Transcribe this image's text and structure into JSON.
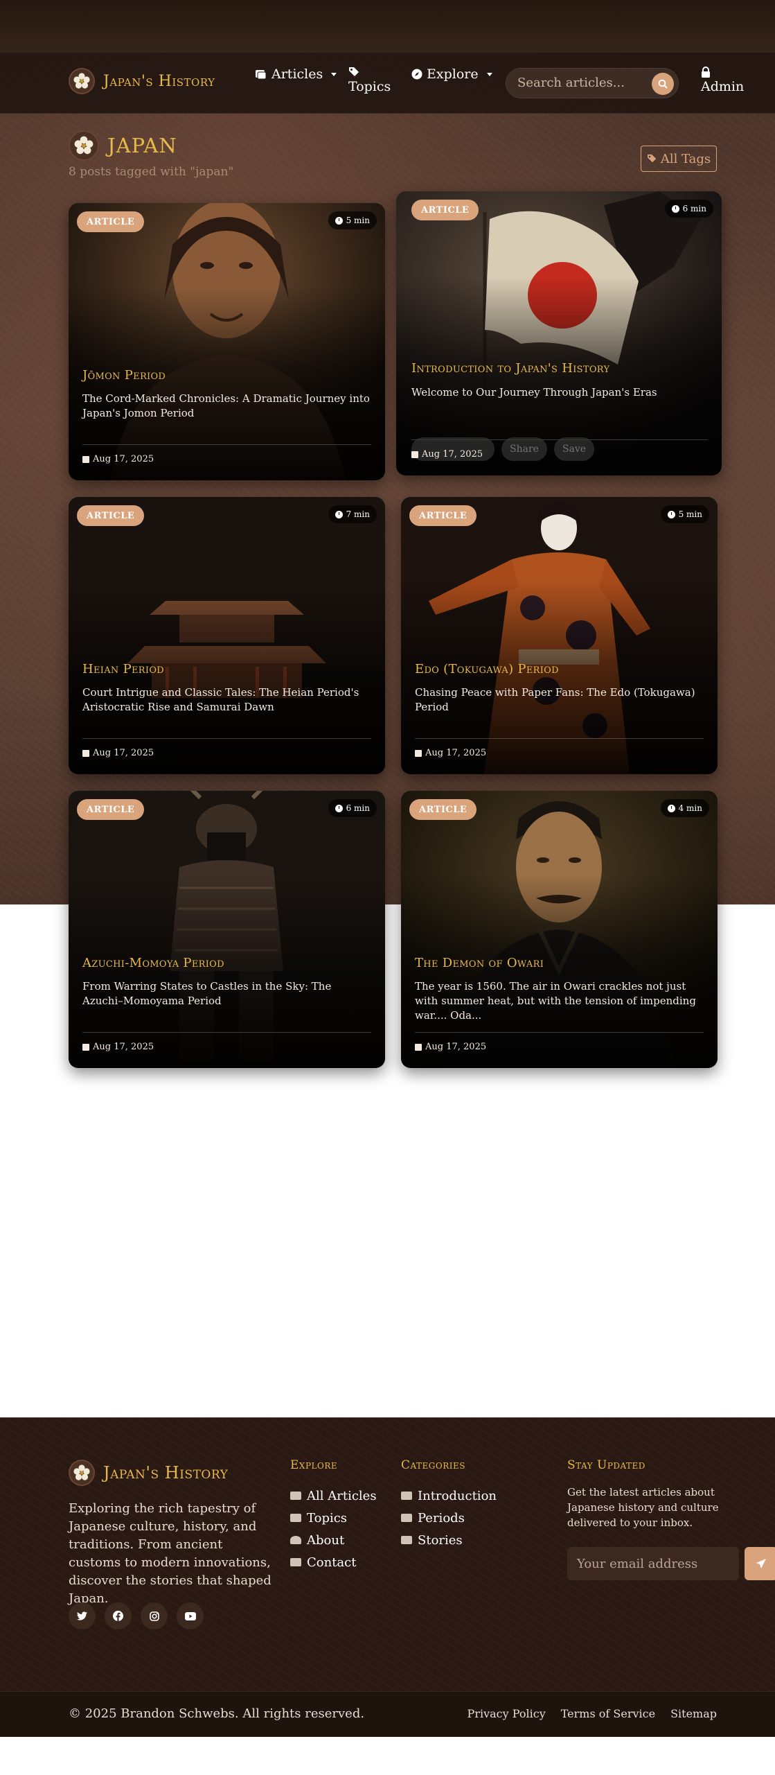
{
  "nav": {
    "brand": "Japan's History",
    "articles": "Articles",
    "topics": "Topics",
    "explore": "Explore",
    "search_placeholder": "Search articles...",
    "admin": "Admin"
  },
  "page": {
    "title": "JAPAN",
    "post_count": "8 posts tagged with \"japan\"",
    "all_tags": "All Tags"
  },
  "cards": [
    {
      "badge": "ARTICLE",
      "read_time": "5 min",
      "title": "Jōmon Period",
      "description": "The Cord-Marked Chronicles: A Dramatic Journey into Japan's Jomon Period",
      "date": "Aug 17, 2025"
    },
    {
      "badge": "ARTICLE",
      "read_time": "6 min",
      "title": "Introduction to Japan's History",
      "description": "Welcome to Our Journey Through Japan's Eras",
      "date": "Aug 17, 2025",
      "actions": [
        "Share",
        "Save"
      ]
    },
    {
      "badge": "ARTICLE",
      "read_time": "7 min",
      "title": "Heian Period",
      "description": "Court Intrigue and Classic Tales: The Heian Period's Aristocratic Rise and Samurai Dawn",
      "date": "Aug 17, 2025"
    },
    {
      "badge": "ARTICLE",
      "read_time": "5 min",
      "title": "Edo (Tokugawa) Period",
      "description": "Chasing Peace with Paper Fans: The Edo (Tokugawa) Period",
      "date": "Aug 17, 2025"
    },
    {
      "badge": "ARTICLE",
      "read_time": "6 min",
      "title": "Azuchi-Momoya Period",
      "description": "From Warring States to Castles in the Sky: The Azuchi–Momoyama Period",
      "date": "Aug 17, 2025"
    },
    {
      "badge": "ARTICLE",
      "read_time": "4 min",
      "title": "The Demon of Owari",
      "description": "The year is 1560. The air in Owari crackles not just with summer heat, but with the tension of impending war.... Oda...",
      "date": "Aug 17, 2025"
    }
  ],
  "footer": {
    "brand": "Japan's History",
    "about": "Exploring the rich tapestry of Japanese culture, history, and traditions. From ancient customs to modern innovations, discover the stories that shaped Japan.",
    "social_icons": [
      "twitter-icon",
      "facebook-icon",
      "instagram-icon",
      "youtube-icon"
    ],
    "explore_heading": "Explore",
    "explore_links": [
      "All Articles",
      "Topics",
      "About",
      "Contact"
    ],
    "categories_heading": "Categories",
    "category_links": [
      "Introduction",
      "Periods",
      "Stories"
    ],
    "newsletter_heading": "Stay Updated",
    "newsletter_text": "Get the latest articles about Japanese history and culture delivered to your inbox.",
    "email_placeholder": "Your email address",
    "copyright": "© 2025 Brandon Schwebs. All rights reserved.",
    "legal_links": [
      "Privacy Policy",
      "Terms of Service",
      "Sitemap"
    ]
  },
  "colors": {
    "accent_gold": "#e7b94a",
    "accent_tan": "#d9a37c",
    "footer_bg": "#2a1913"
  }
}
